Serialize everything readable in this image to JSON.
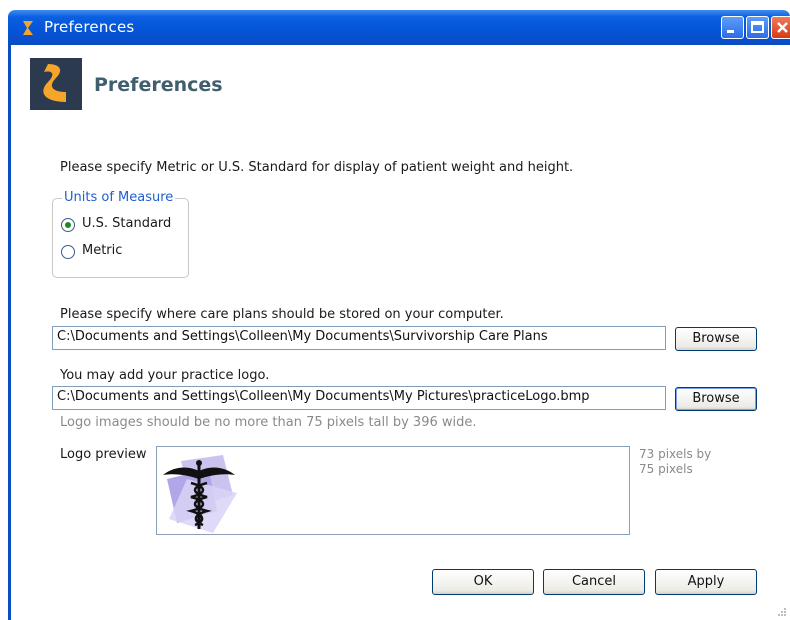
{
  "window": {
    "title": "Preferences"
  },
  "header": {
    "title": "Preferences"
  },
  "units": {
    "instruction": "Please specify Metric or U.S. Standard for display of patient weight and height.",
    "legend": "Units of Measure",
    "options": [
      {
        "label": "U.S. Standard",
        "selected": true
      },
      {
        "label": "Metric",
        "selected": false
      }
    ]
  },
  "careplans": {
    "instruction": "Please specify where care plans should be stored on your computer.",
    "path": "C:\\Documents and Settings\\Colleen\\My Documents\\Survivorship Care Plans",
    "browse_label": "Browse"
  },
  "logo": {
    "instruction": "You may add your practice logo.",
    "path": "C:\\Documents and Settings\\Colleen\\My Documents\\My Pictures\\practiceLogo.bmp",
    "browse_label": "Browse",
    "hint": "Logo images should be no more than 75 pixels tall by 396 wide.",
    "preview_label": "Logo preview",
    "size_note": "73 pixels by\n75 pixels"
  },
  "footer": {
    "ok_label": "OK",
    "cancel_label": "Cancel",
    "apply_label": "Apply"
  },
  "colors": {
    "titlebar": "#0554d8",
    "accent": "#1f5fcf",
    "header_text": "#3f5f6f"
  }
}
